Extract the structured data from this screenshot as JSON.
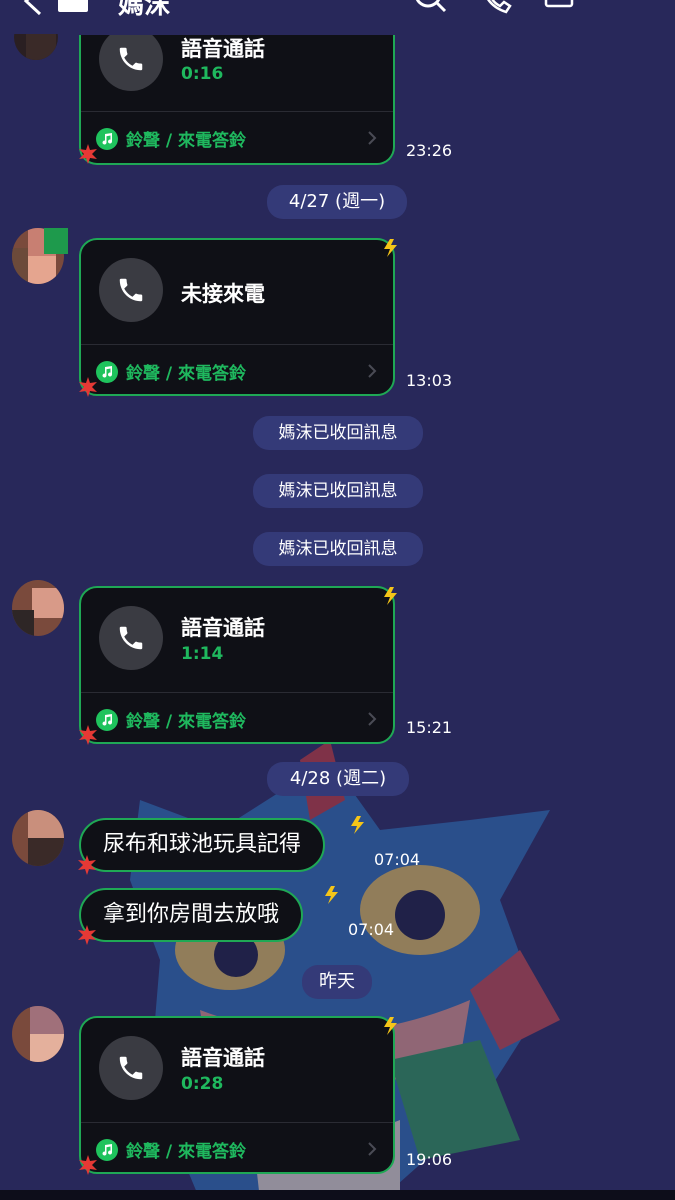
{
  "header": {
    "title": "媽沫"
  },
  "messages": {
    "call1": {
      "title": "語音通話",
      "duration": "0:16",
      "footer": "鈴聲 / 來電答鈴",
      "time": "23:26"
    },
    "date1": "4/27 (週一)",
    "call2": {
      "title": "未接來電",
      "footer": "鈴聲 / 來電答鈴",
      "time": "13:03"
    },
    "unsent": [
      "媽沫已收回訊息",
      "媽沫已收回訊息",
      "媽沫已收回訊息"
    ],
    "call3": {
      "title": "語音通話",
      "duration": "1:14",
      "footer": "鈴聲 / 來電答鈴",
      "time": "15:21"
    },
    "date2": "4/28 (週二)",
    "text1": {
      "text": "尿布和球池玩具記得",
      "time": "07:04"
    },
    "text2": {
      "text": "拿到你房間去放哦",
      "time": "07:04"
    },
    "date3": "昨天",
    "call4": {
      "title": "語音通話",
      "duration": "0:28",
      "footer": "鈴聲 / 來電答鈴",
      "time": "19:06"
    }
  },
  "colors": {
    "background": "#28285a",
    "bubble": "#0f1016",
    "accent_green": "#1fa855",
    "pill": "#343a78"
  }
}
